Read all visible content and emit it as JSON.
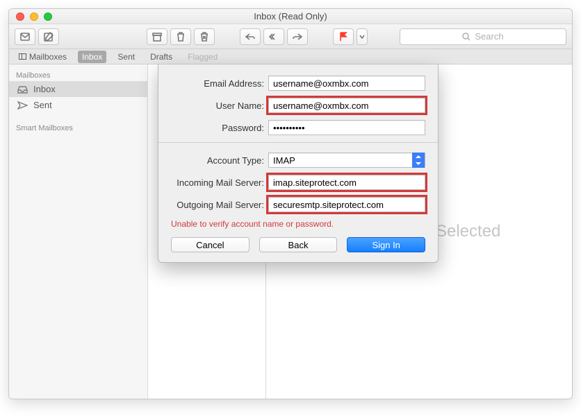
{
  "window": {
    "title": "Inbox (Read Only)"
  },
  "search": {
    "placeholder": "Search"
  },
  "favbar": {
    "mailboxes": "Mailboxes",
    "inbox": "Inbox",
    "sent": "Sent",
    "drafts": "Drafts",
    "flagged": "Flagged"
  },
  "sidebar": {
    "head1": "Mailboxes",
    "inbox": "Inbox",
    "sent": "Sent",
    "head2": "Smart Mailboxes"
  },
  "preview": {
    "text": "No Message Selected"
  },
  "sheet": {
    "labels": {
      "email": "Email Address:",
      "user": "User Name:",
      "password": "Password:",
      "acctype": "Account Type:",
      "incoming": "Incoming Mail Server:",
      "outgoing": "Outgoing Mail Server:"
    },
    "values": {
      "email": "username@oxmbx.com",
      "user": "username@oxmbx.com",
      "password": "••••••••••",
      "acctype": "IMAP",
      "incoming": "imap.siteprotect.com",
      "outgoing": "securesmtp.siteprotect.com"
    },
    "error": "Unable to verify account name or password.",
    "buttons": {
      "cancel": "Cancel",
      "back": "Back",
      "signin": "Sign In"
    }
  }
}
